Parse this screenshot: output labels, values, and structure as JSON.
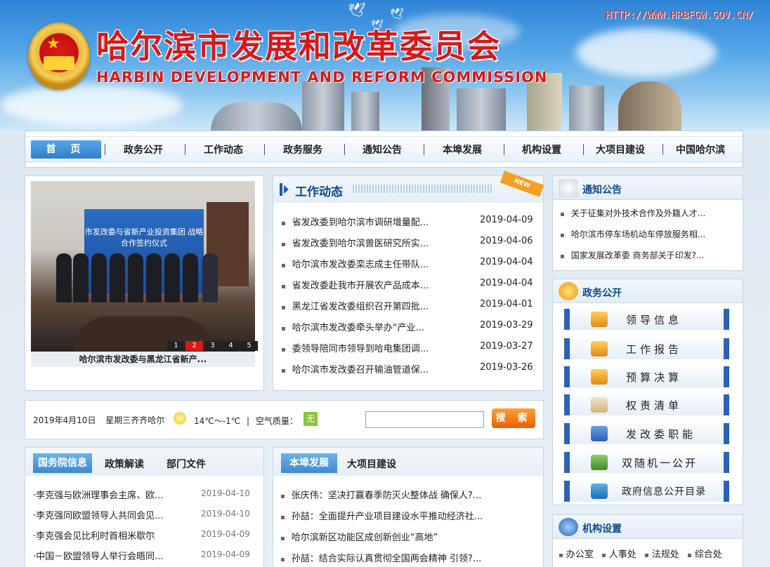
{
  "header": {
    "title_cn": "哈尔滨市发展和改革委员会",
    "title_en": "HARBIN DEVELOPMENT AND REFORM COMMISSION",
    "url": "HTTP://WWW.HRBFGW.GOV.CN/"
  },
  "nav": {
    "home": "首 页",
    "items": [
      "政务公开",
      "工作动态",
      "政务服务",
      "通知公告",
      "本埠发展",
      "机构设置",
      "大项目建设",
      "中国哈尔滨"
    ]
  },
  "slideshow": {
    "board_text": "市发改委与省新产业投资集团 战略合作签约仪式",
    "numbers": [
      "1",
      "2",
      "3",
      "4",
      "5"
    ],
    "active": "2",
    "caption": "哈尔滨市发改委与黑龙江省新产..."
  },
  "work_news": {
    "title": "工作动态",
    "badge": "NEW",
    "items": [
      {
        "title": "省发改委到哈尔滨市调研增量配...",
        "date": "2019-04-09"
      },
      {
        "title": "省发改委到哈尔滨兽医研究所实...",
        "date": "2019-04-06"
      },
      {
        "title": "哈尔滨市发改委栾志成主任带队...",
        "date": "2019-04-04"
      },
      {
        "title": "省发改委赴我市开展农产品成本...",
        "date": "2019-04-04"
      },
      {
        "title": "黑龙江省发改委组织召开第四批...",
        "date": "2019-04-01"
      },
      {
        "title": "哈尔滨市发改委牵头举办“产业...",
        "date": "2019-03-29"
      },
      {
        "title": "委领导陪同市领导到哈电集团调...",
        "date": "2019-03-27"
      },
      {
        "title": "哈尔滨市发改委召开输油管道保...",
        "date": "2019-03-26"
      }
    ]
  },
  "notices": {
    "title": "通知公告",
    "items": [
      "关于征集对外技术合作及外籍人才...",
      "哈尔滨市停车场机动车停放服务相...",
      "国家发展改革委 商务部关于印发?..."
    ]
  },
  "gov_open": {
    "title": "政务公开",
    "buttons": [
      "领导信息",
      "工作报告",
      "预算决算",
      "权责清单",
      "发改委职能",
      "双随机一公开",
      "政府信息公开目录"
    ]
  },
  "weather": {
    "date": "2019年4月10日",
    "weekday_city": "星期三齐齐哈尔",
    "temp": "14℃～-1℃",
    "sep": "|",
    "air_label": "空气质量：",
    "air_value": "无"
  },
  "search": {
    "button": "搜 索",
    "placeholder": ""
  },
  "state_info": {
    "tabs": [
      "国务院信息",
      "政策解读",
      "部门文件"
    ],
    "items": [
      {
        "title": "·李克强与欧洲理事会主席、欧...",
        "date": "2019-04-10"
      },
      {
        "title": "·李克强同欧盟领导人共同会见...",
        "date": "2019-04-10"
      },
      {
        "title": "·李克强会见比利时首相米歇尔",
        "date": "2019-04-09"
      },
      {
        "title": "·中国－欧盟领导人举行会晤同...",
        "date": "2019-04-09"
      }
    ]
  },
  "local_dev": {
    "tabs": [
      "本埠发展",
      "大项目建设"
    ],
    "items": [
      "张庆伟：坚决打赢春季防灭火整体战 确保人?...",
      "孙喆：全面提升产业项目建设水平推动经济社...",
      "哈尔滨新区功能区成创新创业“高地”",
      "孙喆：结合实际认真贯彻全国两会精神 引领?..."
    ]
  },
  "org": {
    "title": "机构设置",
    "items": [
      "办公室",
      "人事处",
      "法规处",
      "综合处"
    ]
  },
  "colors": {
    "accent_blue": "#0d4a8f",
    "brand_red": "#d81818",
    "search_orange": "#f07a10"
  }
}
